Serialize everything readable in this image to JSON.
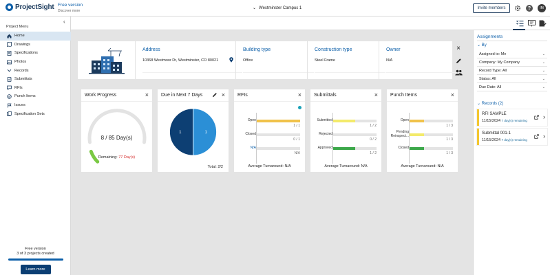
{
  "header": {
    "logo_text": "ProjectSight",
    "version_title": "Free version",
    "version_link": "Discover more",
    "project_name": "Westminster Campus 1",
    "invite_label": "Invite members",
    "help_glyph": "?",
    "avatar_initials": "IM"
  },
  "sidebar": {
    "title": "Project Menu",
    "items": [
      {
        "label": "Home",
        "icon": "home-icon",
        "active": true
      },
      {
        "label": "Drawings",
        "icon": "drawings-icon"
      },
      {
        "label": "Specifications",
        "icon": "specifications-icon"
      },
      {
        "label": "Photos",
        "icon": "photos-icon"
      },
      {
        "label": "Records",
        "icon": "chevron-down-icon"
      },
      {
        "label": "Submittals",
        "icon": "submittals-icon"
      },
      {
        "label": "RFIs",
        "icon": "rfis-icon"
      },
      {
        "label": "Punch Items",
        "icon": "punch-items-icon"
      },
      {
        "label": "Issues",
        "icon": "issues-icon"
      },
      {
        "label": "Specification Sets",
        "icon": "specification-sets-icon"
      }
    ],
    "footer": {
      "plan": "Free version",
      "usage": "3 of 3 projects created",
      "progress_fraction": 1.0,
      "learn_more": "Learn more"
    }
  },
  "info": {
    "address_label": "Address",
    "address_value": "10368 Westmoor Dr, Westminster, CO 80021",
    "building_type_label": "Building type",
    "building_type_value": "Office",
    "construction_type_label": "Construction type",
    "construction_type_value": "Steel Frame",
    "owner_label": "Owner",
    "owner_value": "N/A"
  },
  "widgets": {
    "work_progress": {
      "title": "Work Progress",
      "value_text": "8 / 85 Day(s)",
      "done": 8,
      "total": 85,
      "remaining_label": "Remaining:",
      "remaining_value": "77 Day(s)"
    },
    "due_next": {
      "title": "Due in Next 7 Days",
      "slices": [
        {
          "label": "1",
          "value": 1,
          "color": "#0d3f73"
        },
        {
          "label": "1",
          "value": 1,
          "color": "#2b8fd6"
        }
      ],
      "total_text": "Total: 2/2"
    },
    "rfis": {
      "title": "RFIs",
      "rows": [
        {
          "label": "Open",
          "count": "1 / 1",
          "fraction": 1.0,
          "color": "#f0c24b"
        },
        {
          "label": "Closed",
          "count": "0 / 1",
          "fraction": 0.0,
          "color": "#9c9c9c"
        },
        {
          "label": "N/A",
          "count": "N/A",
          "fraction": 0.0,
          "color": "#9c9c9c"
        }
      ],
      "avg_text": "Average Turnaround: N/A"
    },
    "submittals": {
      "title": "Submittals",
      "rows": [
        {
          "label": "Submitted",
          "count": "1 / 2",
          "fraction": 0.5,
          "color": "#f3ea6b"
        },
        {
          "label": "Rejected",
          "count": "0 / 2",
          "fraction": 0.0,
          "color": "#e07b7b"
        },
        {
          "label": "Approved",
          "count": "1 / 2",
          "fraction": 0.5,
          "color": "#3ca84a"
        }
      ],
      "avg_text": "Average Turnaround: N/A"
    },
    "punch_items": {
      "title": "Punch Items",
      "rows": [
        {
          "label": "Open",
          "count": "1 / 3",
          "fraction": 0.333,
          "color": "#f0c24b"
        },
        {
          "label": "Pending Reinspect...",
          "count": "1 / 3",
          "fraction": 0.333,
          "color": "#f3ea6b"
        },
        {
          "label": "Closed",
          "count": "1 / 3",
          "fraction": 0.333,
          "color": "#3ca84a"
        }
      ],
      "avg_text": "Average Turnaround: N/A"
    }
  },
  "assignments": {
    "title": "Assignments",
    "by_label": "By",
    "filters": [
      "Assigned to: Me",
      "Company: My Company",
      "Record Type: All",
      "Status: All",
      "Due Date: All"
    ],
    "records_label": "Records (2)",
    "records": [
      {
        "title": "RFI SAMPLE",
        "date": "11/15/2024",
        "days": "7 day(s) remaining"
      },
      {
        "title": "Submittal 001-1",
        "date": "11/15/2024",
        "days": "7 day(s) remaining"
      }
    ]
  },
  "colors": {
    "brand": "#0b5ea8",
    "navy": "#1b3a5c",
    "active_menu_bg": "#d9e6f2",
    "progress_arc": "#7ac943",
    "record_accent": "#f3c62f"
  }
}
